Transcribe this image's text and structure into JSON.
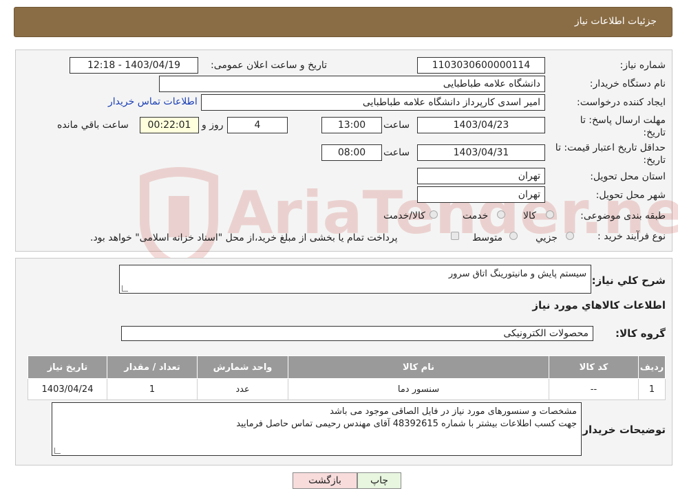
{
  "header": {
    "title": "جزئیات اطلاعات نیاز"
  },
  "form": {
    "need_number_label": "شماره نیاز:",
    "need_number": "1103030600000114",
    "announce_label": "تاریخ و ساعت اعلان عمومی:",
    "announce_value": "1403/04/19 - 12:18",
    "buyer_org_label": "نام دستگاه خریدار:",
    "buyer_org": "دانشگاه علامه طباطبایی",
    "requester_label": "ایجاد کننده درخواست:",
    "requester": "امیر اسدی کارپرداز دانشگاه علامه طباطبایی",
    "contact_link": "اطلاعات تماس خریدار",
    "deadline_label": "مهلت ارسال پاسخ: تا تاریخ:",
    "deadline_date": "1403/04/23",
    "time_label": "ساعت",
    "deadline_time": "13:00",
    "days_value": "4",
    "days_label": "روز و",
    "remaining_value": "00:22:01",
    "remaining_label": "ساعت باقي مانده",
    "validity_label": "حداقل تاریخ اعتبار قیمت: تا تاریخ:",
    "validity_date": "1403/04/31",
    "validity_time": "08:00",
    "province_label": "استان محل تحویل:",
    "province": "تهران",
    "city_label": "شهر محل تحویل:",
    "city": "تهران",
    "category_label": "طبقه بندی موضوعی:",
    "category_options": [
      "کالا",
      "خدمت",
      "کالا/خدمت"
    ],
    "process_label": "نوع فرآیند خرید :",
    "process_options": [
      "جزیي",
      "متوسط"
    ],
    "process_note": "پرداخت تمام یا بخشی از مبلغ خرید،از محل \"اسناد خزانه اسلامی\" خواهد بود."
  },
  "details": {
    "summary_label": "شرح کلي نیاز:",
    "summary": "سیستم پایش و مانیتورینگ اتاق سرور",
    "goods_info_title": "اطلاعات کالاهاي مورد نیاز",
    "group_label": "گروه کالا:",
    "group": "محصولات الکترونیکی",
    "table": {
      "headers": [
        "ردیف",
        "کد کالا",
        "نام کالا",
        "واحد شمارش",
        "تعداد / مقدار",
        "تاریخ نیاز"
      ],
      "rows": [
        [
          "1",
          "--",
          "سنسور دما",
          "عدد",
          "1",
          "1403/04/24"
        ]
      ]
    },
    "buyer_notes_label": "توضیحات خریدار:",
    "buyer_notes_line1": "مشخصات و سنسورهای مورد نیاز در فایل الصاقی موجود می باشد",
    "buyer_notes_line2": "جهت کسب اطلاعات بیشتر با شماره 48392615 آقای مهندس رحیمی تماس حاصل فرمایید"
  },
  "buttons": {
    "print": "چاپ",
    "back": "بازگشت"
  },
  "watermark": "AriaTender.neT"
}
